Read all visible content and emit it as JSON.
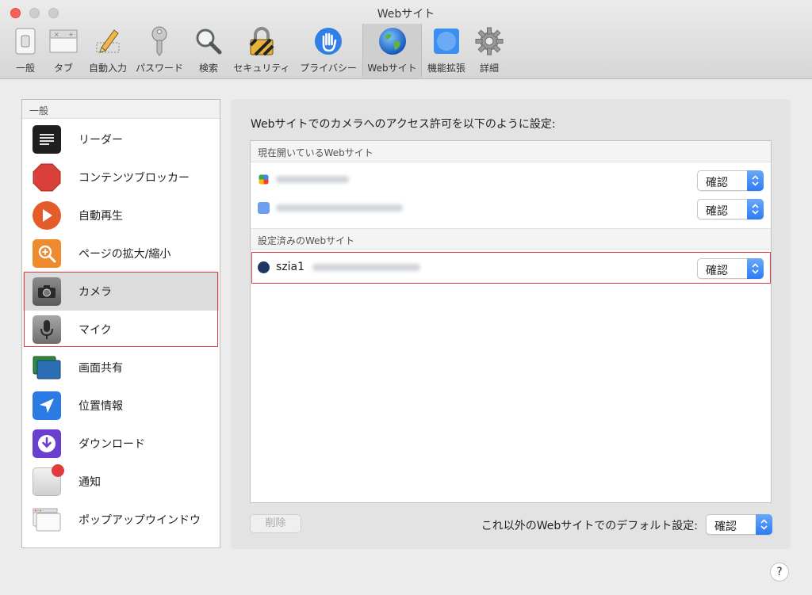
{
  "window": {
    "title": "Webサイト"
  },
  "toolbar": {
    "items": [
      {
        "label": "一般",
        "icon": "switch-icon"
      },
      {
        "label": "タブ",
        "icon": "tabs-icon"
      },
      {
        "label": "自動入力",
        "icon": "pencil-icon"
      },
      {
        "label": "パスワード",
        "icon": "key-icon"
      },
      {
        "label": "検索",
        "icon": "magnifier-icon"
      },
      {
        "label": "セキュリティ",
        "icon": "padlock-icon"
      },
      {
        "label": "プライバシー",
        "icon": "hand-icon"
      },
      {
        "label": "Webサイト",
        "icon": "globe-icon",
        "selected": true
      },
      {
        "label": "機能拡張",
        "icon": "puzzle-icon"
      },
      {
        "label": "詳細",
        "icon": "gear-icon"
      }
    ]
  },
  "sidebar": {
    "header": "一般",
    "items": [
      {
        "label": "リーダー",
        "icon": "reader-icon"
      },
      {
        "label": "コンテンツブロッカー",
        "icon": "stop-sign-icon"
      },
      {
        "label": "自動再生",
        "icon": "play-icon"
      },
      {
        "label": "ページの拡大/縮小",
        "icon": "zoom-icon"
      },
      {
        "label": "カメラ",
        "icon": "camera-icon",
        "selected": true
      },
      {
        "label": "マイク",
        "icon": "microphone-icon"
      },
      {
        "label": "画面共有",
        "icon": "screen-share-icon"
      },
      {
        "label": "位置情報",
        "icon": "location-arrow-icon"
      },
      {
        "label": "ダウンロード",
        "icon": "download-icon"
      },
      {
        "label": "通知",
        "icon": "notification-icon"
      },
      {
        "label": "ポップアップウインドウ",
        "icon": "popup-window-icon"
      }
    ]
  },
  "main": {
    "heading": "Webサイトでのカメラへのアクセス許可を以下のように設定:",
    "open_sites_header": "現在開いているWebサイト",
    "open_sites": [
      {
        "value": "確認"
      },
      {
        "value": "確認"
      }
    ],
    "configured_header": "設定済みのWebサイト",
    "configured_sites": [
      {
        "name": "szia1",
        "value": "確認"
      }
    ],
    "delete_label": "削除",
    "default_label": "これ以外のWebサイトでのデフォルト設定:",
    "default_value": "確認"
  },
  "help": {
    "label": "?"
  }
}
